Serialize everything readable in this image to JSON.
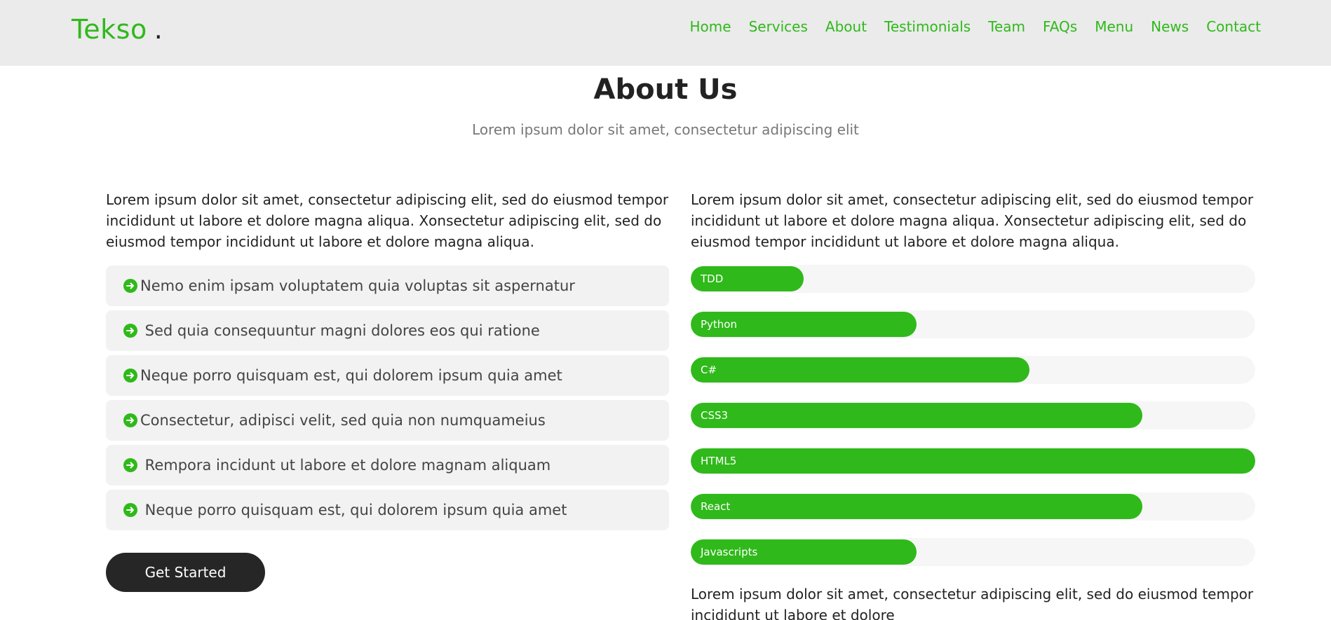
{
  "brand": {
    "name": "Tekso",
    "dot": "."
  },
  "nav": [
    "Home",
    "Services",
    "About",
    "Testimonials",
    "Team",
    "FAQs",
    "Menu",
    "News",
    "Contact"
  ],
  "section": {
    "title": "About Us",
    "subtitle": "Lorem ipsum dolor sit amet, consectetur adipiscing elit"
  },
  "left": {
    "intro": "Lorem ipsum dolor sit amet, consectetur adipiscing elit, sed do eiusmod tempor incididunt ut labore et dolore magna aliqua. Xonsectetur adipiscing elit, sed do eiusmod tempor incididunt ut labore et dolore magna aliqua.",
    "features": [
      "Nemo enim ipsam voluptatem quia voluptas sit aspernatur",
      " Sed quia consequuntur magni dolores eos qui ratione",
      "Neque porro quisquam est, qui dolorem ipsum quia amet",
      "Consectetur, adipisci velit, sed quia non numquameius",
      " Rempora incidunt ut labore et dolore magnam aliquam",
      " Neque porro quisquam est, qui dolorem ipsum quia amet"
    ],
    "cta_label": "Get Started"
  },
  "right": {
    "intro": "Lorem ipsum dolor sit amet, consectetur adipiscing elit, sed do eiusmod tempor incididunt ut labore et dolore magna aliqua. Xonsectetur adipiscing elit, sed do eiusmod tempor incididunt ut labore et dolore magna aliqua.",
    "skills": [
      {
        "name": "TDD",
        "level": 0.2
      },
      {
        "name": "Python",
        "level": 0.4
      },
      {
        "name": "C#",
        "level": 0.6
      },
      {
        "name": "CSS3",
        "level": 0.8
      },
      {
        "name": "HTML5",
        "level": 1.0
      },
      {
        "name": "React",
        "level": 0.8
      },
      {
        "name": "Javascripts",
        "level": 0.4
      }
    ],
    "outro": "Lorem ipsum dolor sit amet, consectetur adipiscing elit, sed do eiusmod tempor incididunt ut labore et dolore"
  },
  "colors": {
    "accent": "#2fb91a",
    "header_bg": "#ebebeb",
    "dark": "#262626",
    "feature_bg": "#f2f2f2",
    "track_bg": "#f6f6f6"
  },
  "icons": {
    "feature_bullet": "arrow-right-circle-icon"
  }
}
